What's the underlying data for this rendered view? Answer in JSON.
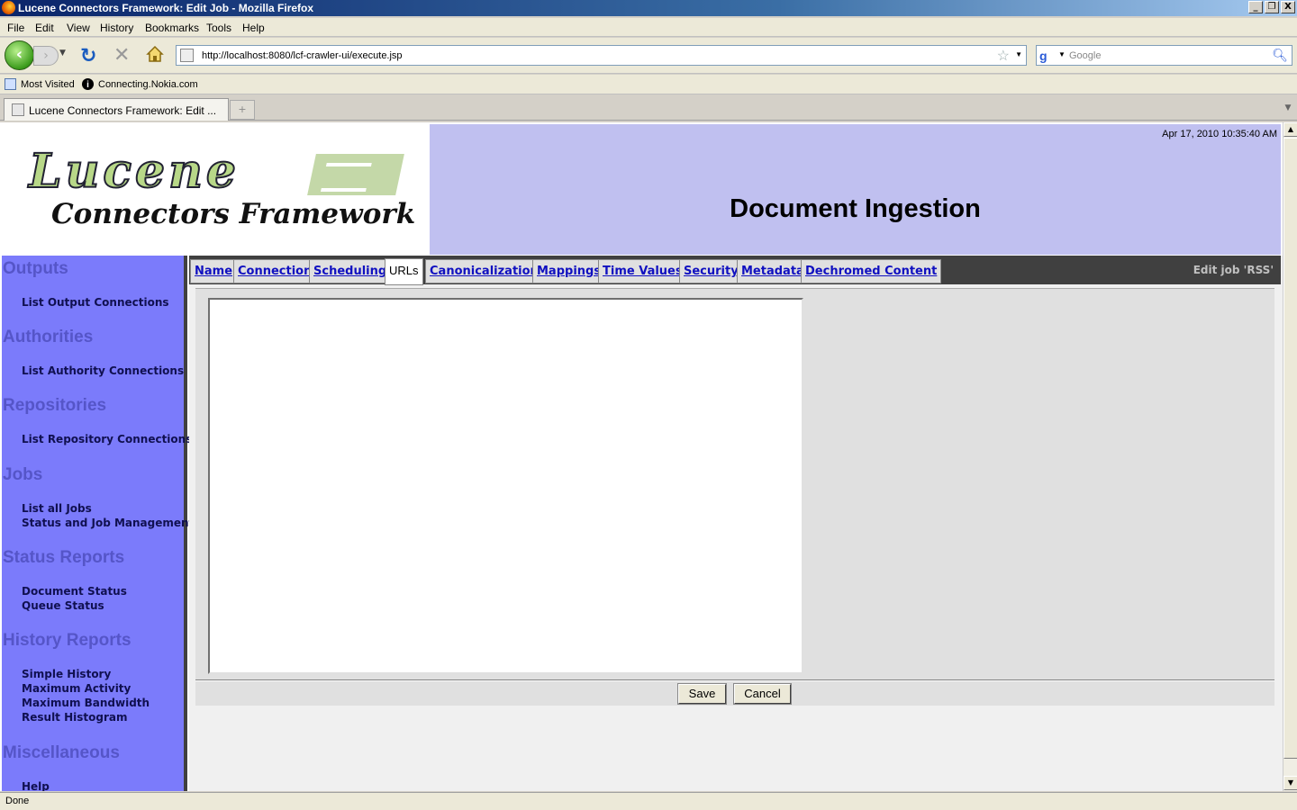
{
  "window": {
    "title": "Lucene Connectors Framework: Edit Job - Mozilla Firefox",
    "minimize": "_",
    "restore": "❐",
    "close": "X"
  },
  "menu": [
    "File",
    "Edit",
    "View",
    "History",
    "Bookmarks",
    "Tools",
    "Help"
  ],
  "nav": {
    "url": "http://localhost:8080/lcf-crawler-ui/execute.jsp",
    "search_placeholder": "Google"
  },
  "bookmarks": [
    "Most Visited",
    "Connecting.Nokia.com"
  ],
  "browser_tab": {
    "label": "Lucene Connectors Framework: Edit ...",
    "new_tab": "+"
  },
  "logo": {
    "word": "Lucene",
    "subtitle": "Connectors Framework"
  },
  "header": {
    "timestamp": "Apr 17, 2010 10:35:40 AM",
    "title": "Document Ingestion"
  },
  "sidebar": {
    "sections": [
      {
        "heading": "Outputs",
        "links": [
          "List Output Connections"
        ]
      },
      {
        "heading": "Authorities",
        "links": [
          "List Authority Connections"
        ]
      },
      {
        "heading": "Repositories",
        "links": [
          "List Repository Connections"
        ]
      },
      {
        "heading": "Jobs",
        "links": [
          "List all Jobs",
          "Status and Job Management"
        ]
      },
      {
        "heading": "Status Reports",
        "links": [
          "Document Status",
          "Queue Status"
        ]
      },
      {
        "heading": "History Reports",
        "links": [
          "Simple History",
          "Maximum Activity",
          "Maximum Bandwidth",
          "Result Histogram"
        ]
      },
      {
        "heading": "Miscellaneous",
        "links": [
          "Help"
        ]
      }
    ]
  },
  "job_tabs": [
    "Name",
    "Connection",
    "Scheduling",
    "URLs",
    "Canonicalization",
    "Mappings",
    "Time Values",
    "Security",
    "Metadata",
    "Dechromed Content"
  ],
  "selected_tab": "URLs",
  "edit_job_label": "Edit job 'RSS'",
  "urls_textarea": "",
  "buttons": {
    "save": "Save",
    "cancel": "Cancel"
  },
  "status": "Done"
}
